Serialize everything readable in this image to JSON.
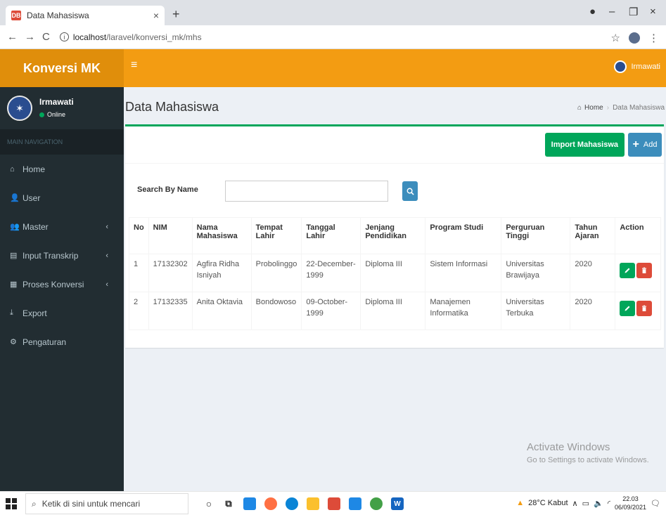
{
  "browser": {
    "tab_title": "Data Mahasiswa",
    "favicon_text": "DB",
    "url_host": "localhost",
    "url_path": "/laravel/konversi_mk/mhs"
  },
  "app": {
    "logo": "Konversi MK",
    "header_user": "Irmawati"
  },
  "sidebar": {
    "user_name": "Irmawati",
    "user_status": "Online",
    "nav_header": "MAIN NAVIGATION",
    "items": [
      {
        "label": "Home",
        "icon": "home-icon",
        "has_children": false
      },
      {
        "label": "User",
        "icon": "user-add-icon",
        "has_children": false
      },
      {
        "label": "Master",
        "icon": "users-icon",
        "has_children": true
      },
      {
        "label": "Input Transkrip",
        "icon": "list-icon",
        "has_children": true
      },
      {
        "label": "Proses Konversi",
        "icon": "list-alt-icon",
        "has_children": true
      },
      {
        "label": "Export",
        "icon": "download-icon",
        "has_children": false
      },
      {
        "label": "Pengaturan",
        "icon": "gear-icon",
        "has_children": false
      }
    ]
  },
  "page": {
    "title": "Data Mahasiswa",
    "breadcrumb": [
      "Home",
      "Data Mahasiswa"
    ],
    "import_button": "Import Mahasiswa",
    "add_button": "Add",
    "search_label": "Search By Name",
    "search_value": ""
  },
  "table": {
    "headers": [
      "No",
      "NIM",
      "Nama Mahasiswa",
      "Tempat Lahir",
      "Tanggal Lahir",
      "Jenjang Pendidikan",
      "Program Studi",
      "Perguruan Tinggi",
      "Tahun Ajaran",
      "Action"
    ],
    "rows": [
      [
        "1",
        "17132302",
        "Agfira Ridha Isniyah",
        "Probolinggo",
        "22-December-1999",
        "Diploma III",
        "Sistem Informasi",
        "Universitas Brawijaya",
        "2020"
      ],
      [
        "2",
        "17132335",
        "Anita Oktavia",
        "Bondowoso",
        "09-October-1999",
        "Diploma III",
        "Manajemen Informatika",
        "Universitas Terbuka",
        "2020"
      ]
    ]
  },
  "watermark": {
    "title": "Activate Windows",
    "subtitle": "Go to Settings to activate Windows."
  },
  "taskbar": {
    "search_placeholder": "Ketik di sini untuk mencari",
    "weather": "28°C  Kabut",
    "time": "22.03",
    "date": "06/09/2021"
  },
  "colors": {
    "header": "#f39c12",
    "logo": "#e08e0b",
    "sidebar": "#222d32",
    "success": "#00a65a",
    "primary": "#3c8dbc",
    "danger": "#dd4b39"
  }
}
